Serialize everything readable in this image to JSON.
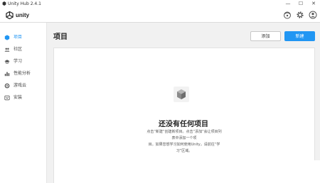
{
  "window": {
    "title": "Unity Hub 2.4.1",
    "controls": [
      "—",
      "☐",
      "✕"
    ]
  },
  "header": {
    "logo_text": "unity",
    "icons": [
      "account-icon",
      "gear-icon",
      "profile-icon"
    ]
  },
  "sidebar": {
    "items": [
      {
        "label": "项目",
        "icon": "cube-icon",
        "active": true
      },
      {
        "label": "社区",
        "icon": "people-icon",
        "active": false
      },
      {
        "label": "学习",
        "icon": "graduation-cap-icon",
        "active": false
      },
      {
        "label": "性能分析",
        "icon": "chart-icon",
        "active": false
      },
      {
        "label": "游戏云",
        "icon": "cloud-gear-icon",
        "active": false
      },
      {
        "label": "安装",
        "icon": "install-icon",
        "active": false
      }
    ]
  },
  "main": {
    "title": "项目",
    "add_label": "添加",
    "new_label": "新建",
    "empty_title": "还没有任何项目",
    "empty_desc_line1": "点击“新建”创建新项目。点击“添加”会让项目列表中添加一个项",
    "empty_desc_line2": "目。如果您想学习如何使用Unity，请前往“学习”区域。"
  },
  "colors": {
    "accent": "#2196f3",
    "background": "#f1f1f1",
    "card": "#ffffff"
  }
}
